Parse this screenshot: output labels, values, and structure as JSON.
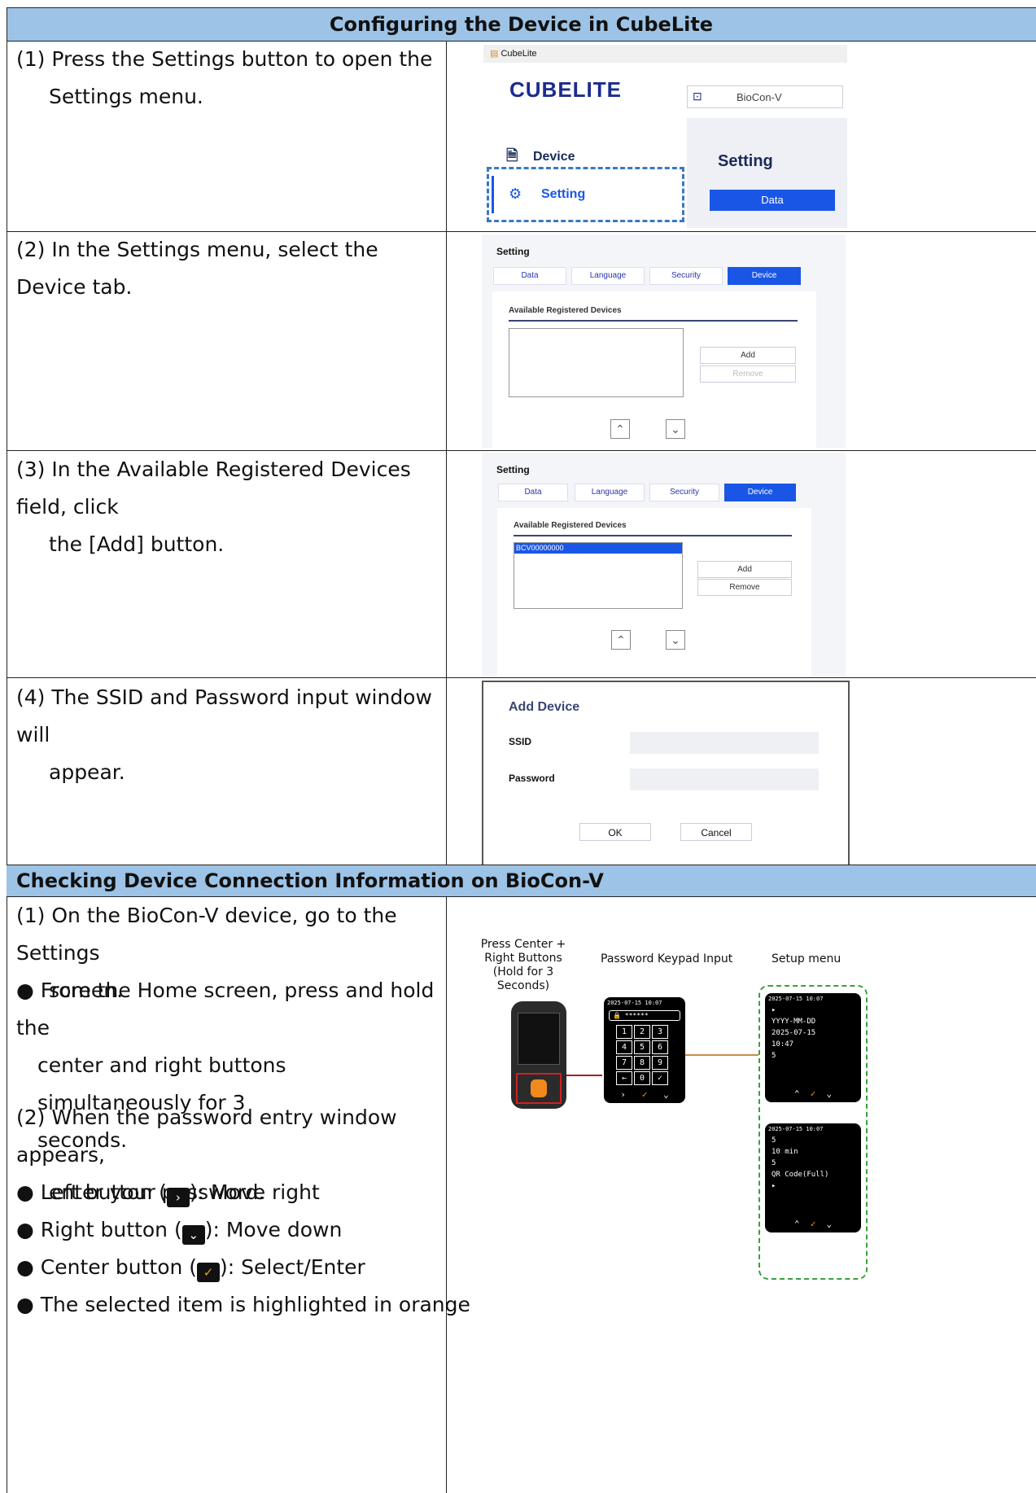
{
  "section1": {
    "title": "Configuring the Device in CubeLite",
    "steps": [
      {
        "num": "(1)",
        "line1": "Press the Settings button to open the",
        "line2": "Settings menu."
      },
      {
        "num": "(2)",
        "line1": "In the Settings menu, select the Device tab.",
        "line2": ""
      },
      {
        "num": "(3)",
        "line1": "In the Available Registered Devices field, click",
        "line2": "the [Add] button."
      },
      {
        "num": "(4)",
        "line1": "The SSID and Password input window will",
        "line2": "appear."
      }
    ],
    "shot1": {
      "window_title": "CubeLite",
      "logo": "CUBELITE",
      "device_name": "BioCon-V",
      "menu_device": "Device",
      "menu_setting": "Setting",
      "panel_title": "Setting",
      "panel_button": "Data"
    },
    "settings": {
      "title": "Setting",
      "tabs": [
        "Data",
        "Language",
        "Security",
        "Device"
      ],
      "active_tab": "Device",
      "section_label": "Available Registered Devices",
      "add": "Add",
      "remove": "Remove",
      "device_item": "BCV00000000"
    },
    "dialog": {
      "title": "Add Device",
      "ssid_label": "SSID",
      "password_label": "Password",
      "ok": "OK",
      "cancel": "Cancel"
    }
  },
  "section2": {
    "title": "Checking Device Connection Information on BioCon-V",
    "step1_line1": "(1) On the BioCon-V device, go to the Settings",
    "step1_line2": "screen.",
    "bullet1_line1": "From the Home screen, press and hold the",
    "bullet1_line2": "center and right buttons simultaneously for 3",
    "bullet1_line3": "seconds.",
    "step2_line1": "(2) When the password entry window appears,",
    "step2_line2": "enter your password.",
    "bullet_left_a": "Left button (",
    "bullet_left_b": "): Move right",
    "bullet_right_a": "Right button (",
    "bullet_right_b": "): Move down",
    "bullet_center_a": "Center button (",
    "bullet_center_b": "): Select/Enter",
    "bullet_last": "The selected item is highlighted in orange",
    "figure": {
      "label_press": "Press Center + Right Buttons (Hold for 3 Seconds)",
      "label_keypad": "Password Keypad Input",
      "label_setup": "Setup menu",
      "lcd_time": "2025-07-15 10:07",
      "lcd_password": "******",
      "keys": [
        "1",
        "2",
        "3",
        "4",
        "5",
        "6",
        "7",
        "8",
        "9",
        "←",
        "0",
        "✓"
      ],
      "setup1": [
        "▸",
        "YYYY-MM-DD",
        "2025-07-15",
        "10:47",
        "5"
      ],
      "setup2": [
        "5",
        "10 min",
        "5",
        "QR Code(Full)",
        "▸"
      ]
    }
  }
}
